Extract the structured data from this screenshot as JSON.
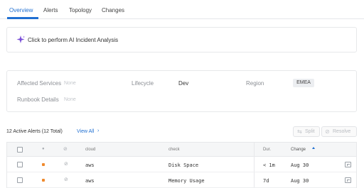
{
  "tabs": [
    {
      "label": "Overview",
      "active": true
    },
    {
      "label": "Alerts",
      "active": false
    },
    {
      "label": "Topology",
      "active": false
    },
    {
      "label": "Changes",
      "active": false
    }
  ],
  "ai_panel": {
    "label": "Click to perform AI Incident Analysis",
    "icon": "sparkle-icon"
  },
  "info": {
    "affected_services_label": "Affected Services",
    "affected_services_value": "None",
    "lifecycle_label": "Lifecycle",
    "lifecycle_value": "Dev",
    "region_label": "Region",
    "region_value": "EMEA",
    "runbook_label": "Runbook Details",
    "runbook_value": "None"
  },
  "alerts_bar": {
    "summary": "12 Active Alerts (12 Total)",
    "view_all": "View All",
    "view_all_chevron": "›",
    "split_label": "Split",
    "resolve_label": "Resolve"
  },
  "table": {
    "columns": [
      "cloud",
      "check",
      "Dur.",
      "Change"
    ],
    "rows": [
      {
        "cloud": "aws",
        "check": "Disk Space",
        "dur": "< 1m",
        "change": "Aug 30"
      },
      {
        "cloud": "aws",
        "check": "Memory Usage",
        "dur": "7d",
        "change": "Aug 30"
      }
    ]
  },
  "colors": {
    "accent": "#1f6fd1",
    "severity": "#ef8a2e"
  }
}
